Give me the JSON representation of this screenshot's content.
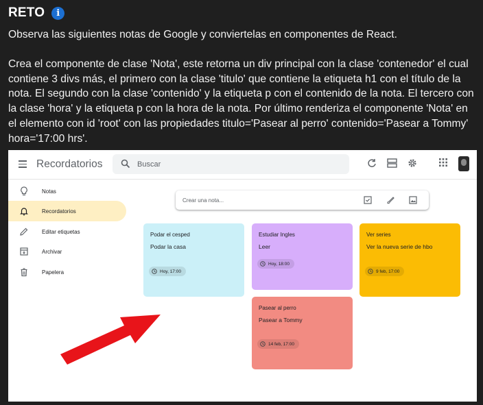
{
  "header": {
    "title": "RETO",
    "info_icon": "i"
  },
  "description": {
    "p1": "Observa las siguientes notas de Google y conviertelas en componentes de React.",
    "p2": "Crea el componente de clase 'Nota', este retorna un div principal con la clase 'contenedor' el cual contiene 3 divs más, el primero con la clase 'titulo' que contiene la etiqueta h1 con el título de la nota. El segundo con la clase 'contenido' y la etiqueta p con el contenido de la nota. El tercero con la clase 'hora' y la etiqueta p con la hora de la nota. Por último renderiza el componente 'Nota' en el elemento con id 'root' con las propiedades titulo='Pasear al perro' contenido='Pasear a Tommy' hora='17:00 hrs'."
  },
  "keep": {
    "app_title": "Recordatorios",
    "search_placeholder": "Buscar",
    "sidebar": [
      {
        "label": "Notas",
        "icon": "lightbulb-icon"
      },
      {
        "label": "Recordatorios",
        "icon": "bell-icon",
        "active": true
      },
      {
        "label": "Editar etiquetas",
        "icon": "pencil-icon"
      },
      {
        "label": "Archivar",
        "icon": "archive-icon"
      },
      {
        "label": "Papelera",
        "icon": "trash-icon"
      }
    ],
    "compose_placeholder": "Crear una nota...",
    "notes": [
      {
        "title": "Podar el cesped",
        "content": "Podar la casa",
        "time": "Hoy, 17:00",
        "color": "#cbf0f8"
      },
      {
        "title": "Estudiar Ingles",
        "content": "Leer",
        "time": "Hoy, 18:00",
        "color": "#d7aefb"
      },
      {
        "title": "Ver series",
        "content": "Ver la nueva serie de hbo",
        "time": "9 feb, 17:00",
        "color": "#fbbc04"
      },
      {
        "title": "Pasear al perro",
        "content": "Pasear a Tommy",
        "time": "14 feb, 17:00",
        "color": "#f28b82"
      }
    ],
    "arrow_color": "#e8141a"
  }
}
